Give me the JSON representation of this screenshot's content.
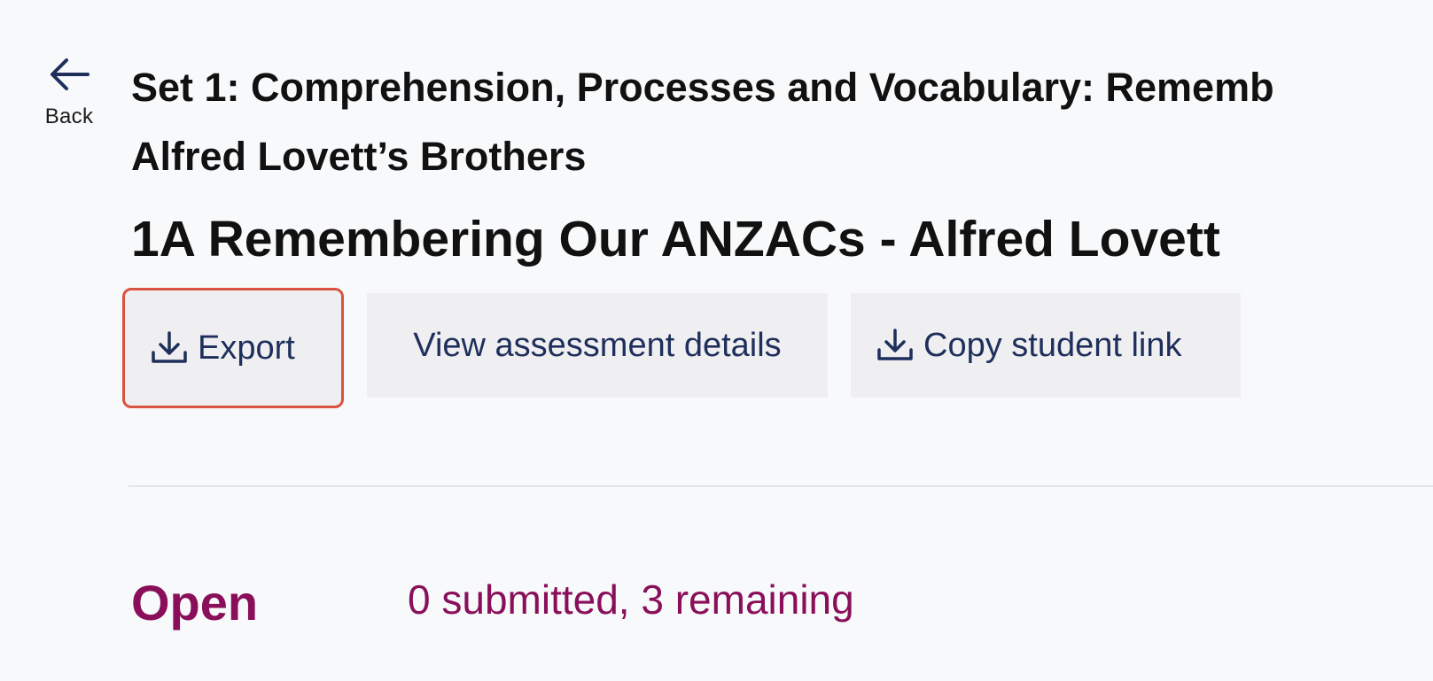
{
  "back": {
    "label": "Back",
    "icon": "arrow-left-icon"
  },
  "breadcrumb": {
    "line1": "Set 1: Comprehension, Processes and Vocabulary: Rememb",
    "line2": "Alfred Lovett’s Brothers"
  },
  "page_title": "1A Remembering Our ANZACs - Alfred Lovett",
  "actions": {
    "export": {
      "label": "Export",
      "icon": "download-icon"
    },
    "view_details": {
      "label": "View assessment details"
    },
    "copy_link": {
      "label": "Copy student link",
      "icon": "download-icon"
    }
  },
  "status": {
    "label": "Open",
    "summary": "0 submitted, 3 remaining"
  },
  "colors": {
    "accent_text": "#1f2f5c",
    "highlight_border": "#d9533f",
    "status": "#8a0f5a",
    "button_bg": "#efeff1",
    "page_bg": "#f8f9fb"
  }
}
